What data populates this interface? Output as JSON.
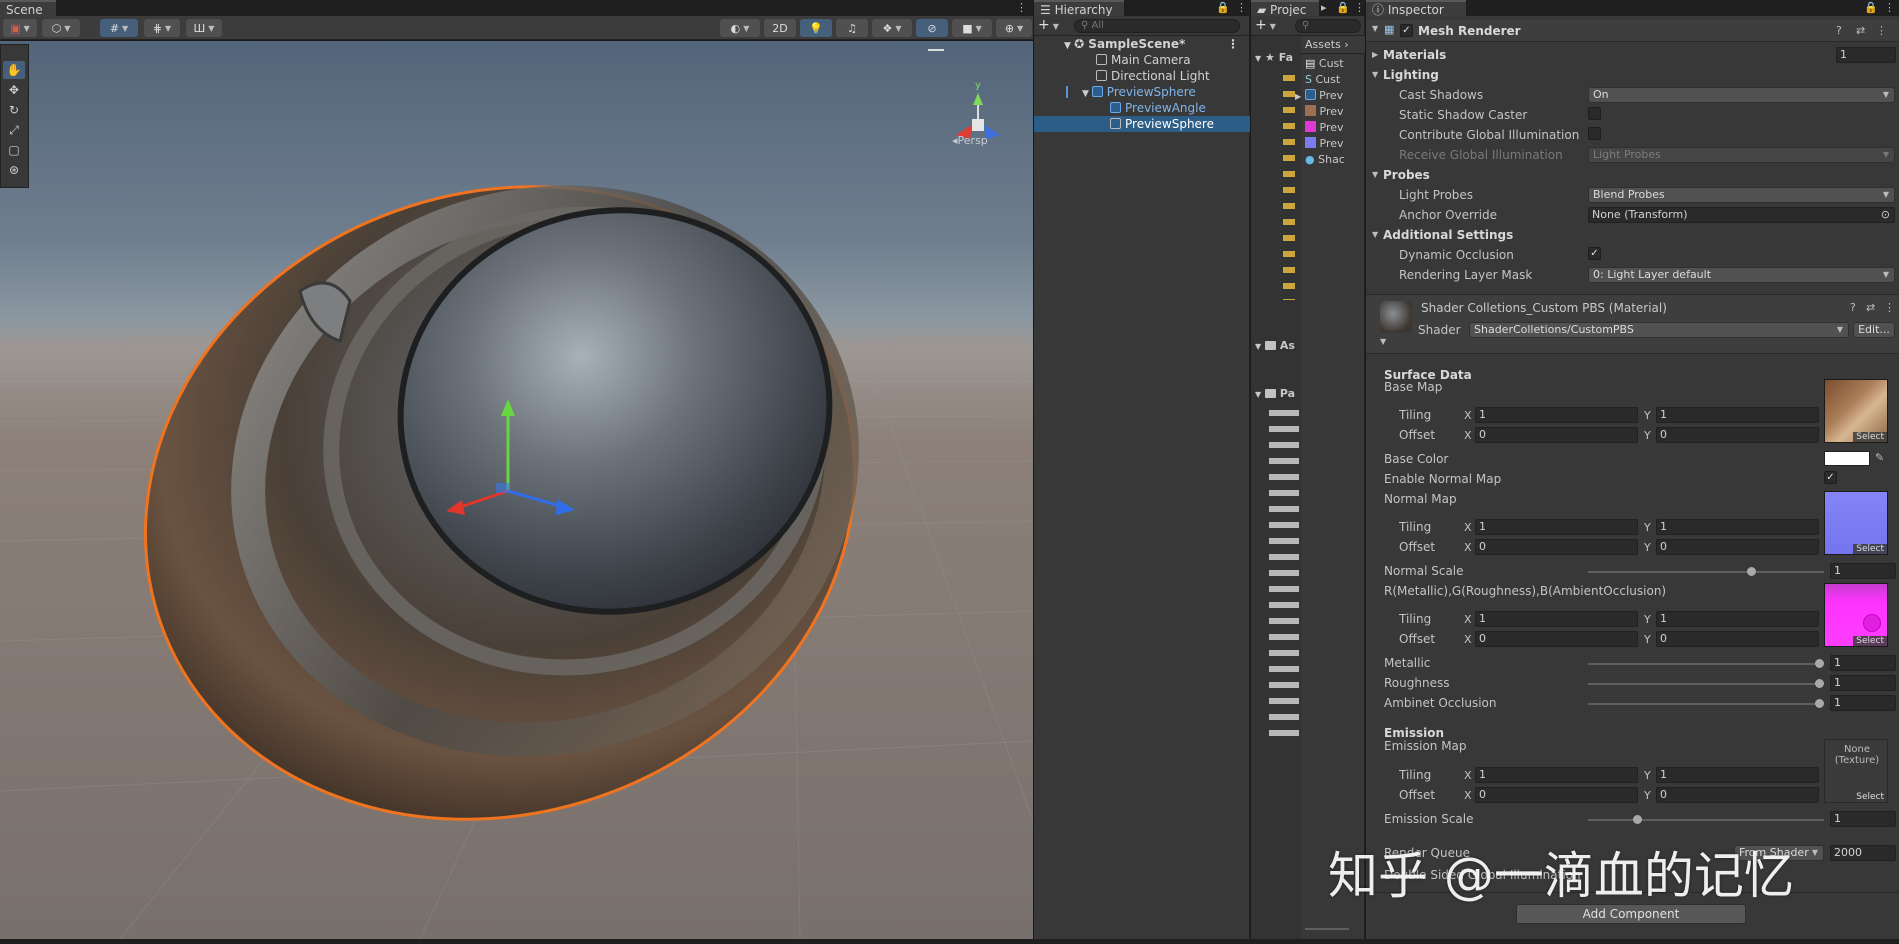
{
  "scene": {
    "tab_label": "Scene",
    "toolbar": {
      "mode_2d": "2D"
    },
    "persp_label": "Persp",
    "axis_x": "x",
    "axis_y": "y",
    "axis_z": "z"
  },
  "hierarchy": {
    "tab_label": "Hierarchy",
    "search_placeholder": "All",
    "rows": [
      {
        "label": "SampleScene*"
      },
      {
        "label": "Main Camera"
      },
      {
        "label": "Directional Light"
      },
      {
        "label": "PreviewSphere"
      },
      {
        "label": "PreviewAngle"
      },
      {
        "label": "PreviewSphere"
      }
    ]
  },
  "project": {
    "tab_label": "Projec",
    "assets_label": "Assets",
    "fav_label": "Fa",
    "assets_tree_label": "As",
    "packages_tree_label": "Pa",
    "files": [
      "Cust",
      "Cust",
      "Prev",
      "Prev",
      "Prev",
      "Prev",
      "Shac"
    ]
  },
  "inspector": {
    "tab_label": "Inspector",
    "component_title": "Mesh Renderer",
    "materials": {
      "label": "Materials",
      "value": "1"
    },
    "lighting": {
      "header": "Lighting",
      "cast_shadows_label": "Cast Shadows",
      "cast_shadows_value": "On",
      "static_shadow_label": "Static Shadow Caster",
      "contribute_gi_label": "Contribute Global Illumination",
      "receive_gi_label": "Receive Global Illumination",
      "receive_gi_value": "Light Probes"
    },
    "probes": {
      "header": "Probes",
      "light_probes_label": "Light Probes",
      "light_probes_value": "Blend Probes",
      "anchor_label": "Anchor Override",
      "anchor_value": "None (Transform)"
    },
    "additional": {
      "header": "Additional Settings",
      "dynamic_occlusion_label": "Dynamic Occlusion",
      "layer_mask_label": "Rendering Layer Mask",
      "layer_mask_value": "0: Light Layer default"
    },
    "material": {
      "title": "Shader Colletions_Custom PBS (Material)",
      "shader_label": "Shader",
      "shader_value": "ShaderColletions/CustomPBS",
      "edit_label": "Edit..."
    },
    "surface": {
      "header": "Surface Data",
      "base_map_label": "Base Map",
      "tiling_label": "Tiling",
      "offset_label": "Offset",
      "x_label": "X",
      "y_label": "Y",
      "base_tiling_x": "1",
      "base_tiling_y": "1",
      "base_offset_x": "0",
      "base_offset_y": "0",
      "base_color_label": "Base Color",
      "enable_normal_label": "Enable Normal Map",
      "normal_map_label": "Normal Map",
      "normal_tiling_x": "1",
      "normal_tiling_y": "1",
      "normal_offset_x": "0",
      "normal_offset_y": "0",
      "normal_scale_label": "Normal Scale",
      "normal_scale_value": "1",
      "mra_label": "R(Metallic),G(Roughness),B(AmbientOcclusion)",
      "mra_tiling_x": "1",
      "mra_tiling_y": "1",
      "mra_offset_x": "0",
      "mra_offset_y": "0",
      "metallic_label": "Metallic",
      "metallic_value": "1",
      "roughness_label": "Roughness",
      "roughness_value": "1",
      "ao_label": "Ambinet Occlusion",
      "ao_value": "1",
      "select_label": "Select"
    },
    "emission": {
      "header": "Emission",
      "map_label": "Emission Map",
      "none_texture": "None (Texture)",
      "tiling_x": "1",
      "tiling_y": "1",
      "offset_x": "0",
      "offset_y": "0",
      "scale_label": "Emission Scale",
      "scale_value": "1",
      "render_queue_label": "Render Queue",
      "render_queue_source": "From Shader",
      "render_queue_value": "2000",
      "double_sided_label": "Double Sided Global Illumination"
    },
    "add_component_label": "Add Component"
  },
  "watermark": "知乎 @一滴血的记忆",
  "slider_levels": {
    "normal_scale": 0.7,
    "metallic": 1.0,
    "roughness": 1.0,
    "ao": 1.0,
    "emission_scale": 0.2
  },
  "colors": {
    "selection": "#2c5d87",
    "outline": "#f07320",
    "accent_blue": "#46607c"
  }
}
